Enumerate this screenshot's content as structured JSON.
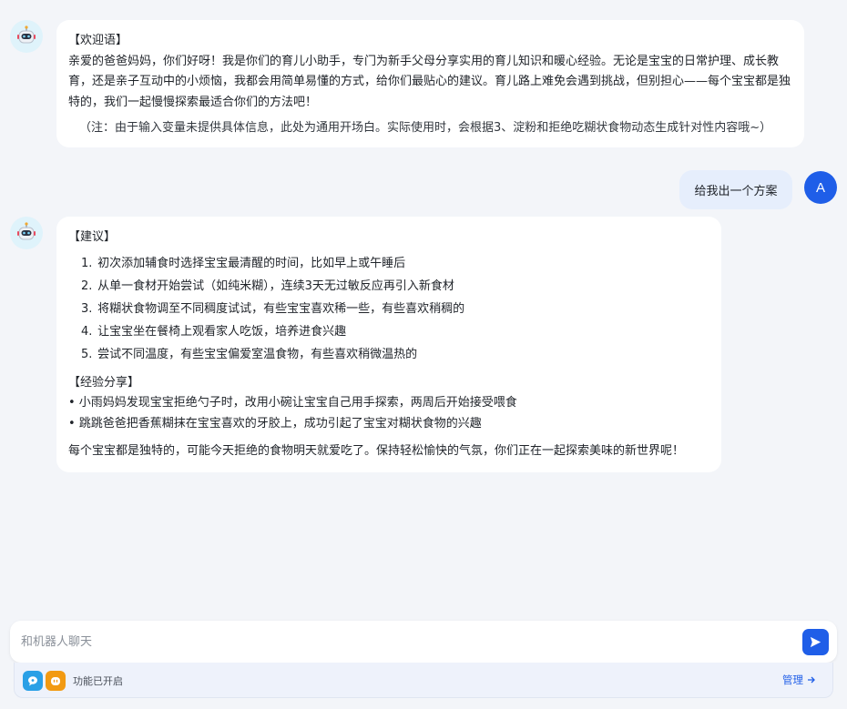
{
  "messages": {
    "welcome": {
      "heading": "【欢迎语】",
      "body": "亲爱的爸爸妈妈，你们好呀！我是你们的育儿小助手，专门为新手父母分享实用的育儿知识和暖心经验。无论是宝宝的日常护理、成长教育，还是亲子互动中的小烦恼，我都会用简单易懂的方式，给你们最贴心的建议。育儿路上难免会遇到挑战，但别担心——每个宝宝都是独特的，我们一起慢慢探索最适合你们的方法吧！",
      "note": "（注：由于输入变量未提供具体信息，此处为通用开场白。实际使用时，会根据3、淀粉和拒绝吃糊状食物动态生成针对性内容哦~）"
    },
    "user": {
      "text": "给我出一个方案",
      "avatar_letter": "A"
    },
    "reply": {
      "heading": "【建议】",
      "items": [
        {
          "num": "1.",
          "text": "初次添加辅食时选择宝宝最清醒的时间，比如早上或午睡后"
        },
        {
          "num": "2.",
          "text": "从单一食材开始尝试（如纯米糊），连续3天无过敏反应再引入新食材"
        },
        {
          "num": "3.",
          "text": "将糊状食物调至不同稠度试试，有些宝宝喜欢稀一些，有些喜欢稍稠的"
        },
        {
          "num": "4.",
          "text": "让宝宝坐在餐椅上观看家人吃饭，培养进食兴趣"
        },
        {
          "num": "5.",
          "text": "尝试不同温度，有些宝宝偏爱室温食物，有些喜欢稍微温热的"
        }
      ],
      "share_heading": "【经验分享】",
      "shares": [
        "• 小雨妈妈发现宝宝拒绝勺子时，改用小碗让宝宝自己用手探索，两周后开始接受喂食",
        "• 跳跳爸爸把香蕉糊抹在宝宝喜欢的牙胶上，成功引起了宝宝对糊状食物的兴趣"
      ],
      "closing": "每个宝宝都是独特的，可能今天拒绝的食物明天就爱吃了。保持轻松愉快的气氛，你们正在一起探索美味的新世界呢！"
    }
  },
  "input": {
    "placeholder": "和机器人聊天",
    "value": ""
  },
  "footer": {
    "status_text": "功能已开启",
    "manage_label": "管理"
  },
  "icons": {
    "bot_avatar": "robot-icon",
    "send": "send-icon",
    "feature_1": "chat-bubble-icon",
    "feature_2": "bot-face-icon",
    "manage_arrow": "arrow-right-icon"
  },
  "colors": {
    "accent": "#1f5ee8",
    "background": "#f3f5f9",
    "user_bubble": "#e6eefc",
    "feature_1": "#2aa0e6",
    "feature_2": "#f29a12"
  }
}
